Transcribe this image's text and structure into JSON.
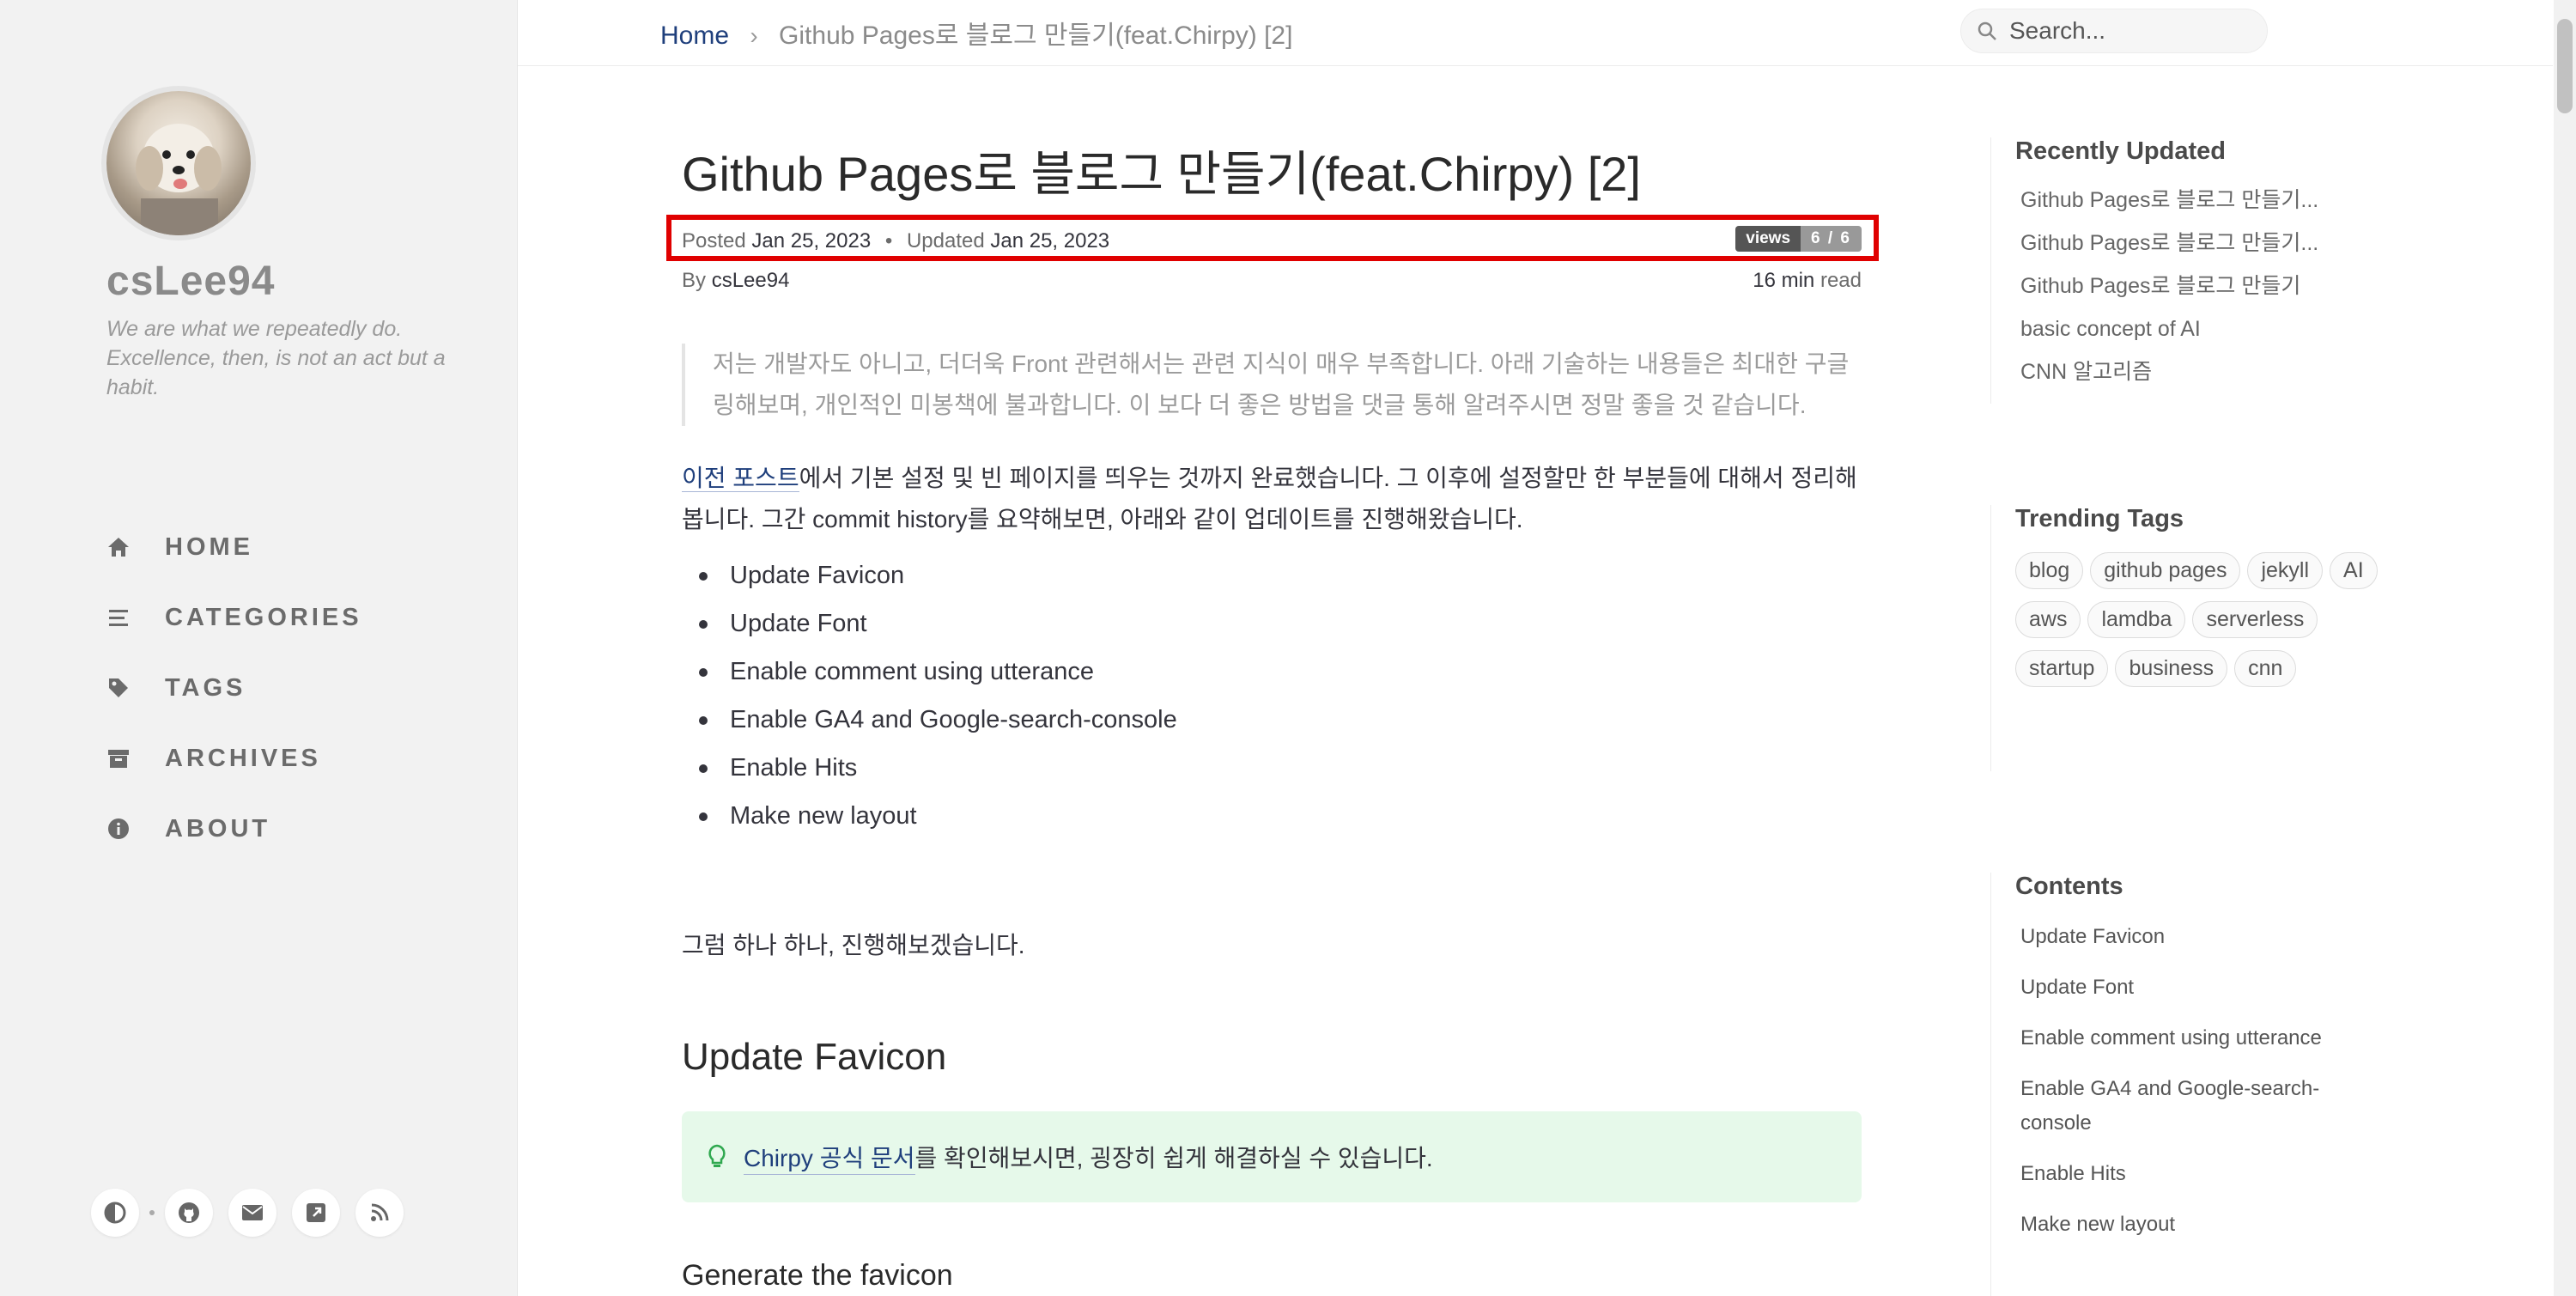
{
  "sidebar": {
    "site_title": "csLee94",
    "site_subtitle": "We are what we repeatedly do. Excellence, then, is not an act but a habit.",
    "nav": [
      {
        "label": "HOME",
        "icon": "home-icon"
      },
      {
        "label": "CATEGORIES",
        "icon": "stream-icon"
      },
      {
        "label": "TAGS",
        "icon": "tag-icon"
      },
      {
        "label": "ARCHIVES",
        "icon": "archive-icon"
      },
      {
        "label": "ABOUT",
        "icon": "info-icon"
      }
    ],
    "bottom_icons": [
      "theme-toggle-icon",
      "github-icon",
      "email-icon",
      "share-icon",
      "rss-icon"
    ]
  },
  "topbar": {
    "breadcrumb_home": "Home",
    "breadcrumb_sep": "›",
    "breadcrumb_current": "Github Pages로 블로그 만들기(feat.Chirpy) [2]",
    "search_placeholder": "Search..."
  },
  "post": {
    "title": "Github Pages로 블로그 만들기(feat.Chirpy) [2]",
    "posted_label": "Posted",
    "posted_date": "Jan 25, 2023",
    "meta_sep": "•",
    "updated_label": "Updated",
    "updated_date": "Jan 25, 2023",
    "views_label": "views",
    "views_value": "6 / 6",
    "by_label": "By",
    "author": "csLee94",
    "read_time": "16 min",
    "read_label": "read",
    "quote": "저는 개발자도 아니고, 더더욱 Front 관련해서는 관련 지식이 매우 부족합니다. 아래 기술하는 내용들은 최대한 구글링해보며, 개인적인 미봉책에 불과합니다. 이 보다 더 좋은 방법을 댓글 통해 알려주시면 정말 좋을 것 같습니다.",
    "intro_link": "이전 포스트",
    "intro_text": "에서 기본 설정 및 빈 페이지를 띄우는 것까지 완료했습니다. 그 이후에 설정할만 한 부분들에 대해서 정리해봅니다. 그간 commit history를 요약해보면, 아래와 같이 업데이트를 진행해왔습니다.",
    "bullets": [
      "Update Favicon",
      "Update Font",
      "Enable comment using utterance",
      "Enable GA4 and Google-search-console",
      "Enable Hits",
      "Make new layout"
    ],
    "outro": "그럼 하나 하나, 진행해보겠습니다.",
    "section_title": "Update Favicon",
    "tip_link": "Chirpy 공식 문서",
    "tip_text": "를 확인해보시면, 굉장히 쉽게 해결하실 수 있습니다.",
    "subsection_title": "Generate the favicon"
  },
  "panel": {
    "recent_title": "Recently Updated",
    "recent": [
      "Github Pages로 블로그 만들기...",
      "Github Pages로 블로그 만들기...",
      "Github Pages로 블로그 만들기",
      "basic concept of AI",
      "CNN 알고리즘"
    ],
    "tags_title": "Trending Tags",
    "tags": [
      "blog",
      "github pages",
      "jekyll",
      "AI",
      "aws",
      "lamdba",
      "serverless",
      "startup",
      "business",
      "cnn"
    ],
    "toc_title": "Contents",
    "toc": [
      "Update Favicon",
      "Update Font",
      "Enable comment using utterance",
      "Enable GA4 and Google-search-console",
      "Enable Hits",
      "Make new layout"
    ]
  },
  "colors": {
    "link": "#1f3f7c",
    "highlight_box": "#e00000",
    "tip_background": "#e6f9ea",
    "tip_icon": "#2fa84f"
  }
}
